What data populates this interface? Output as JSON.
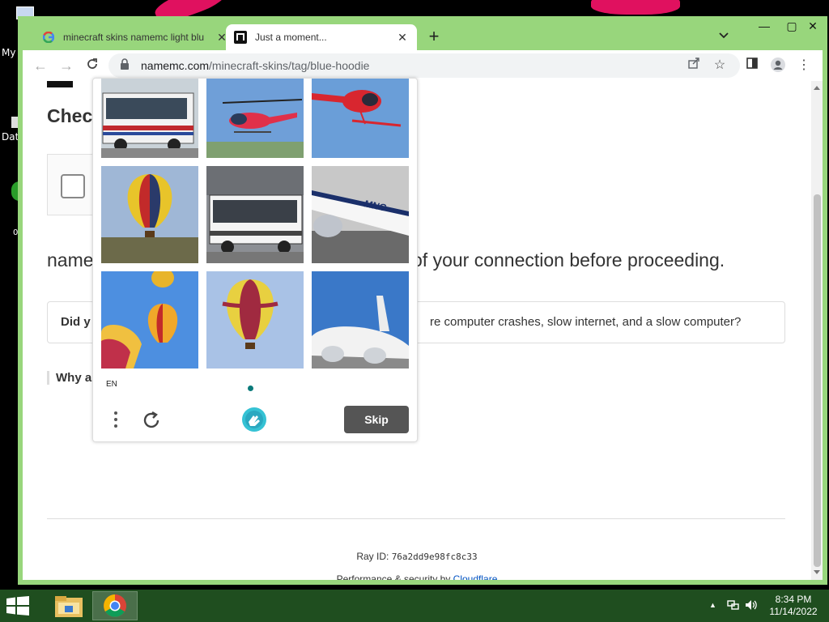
{
  "desktop": {
    "icon_labels": [
      "My",
      "Dat",
      "0"
    ]
  },
  "browser": {
    "tabs": [
      {
        "title": "minecraft skins namemc light blu",
        "favicon": "google-icon",
        "active": false
      },
      {
        "title": "Just a moment...",
        "favicon": "namemc-icon",
        "active": true
      }
    ],
    "url_host": "namemc.com",
    "url_path": "/minecraft-skins/tag/blue-hoodie"
  },
  "page": {
    "heading_partial": "Checl",
    "connection_left": "name",
    "connection_right": "of your connection before proceeding.",
    "ad_left": "Did y",
    "ad_right": "re computer crashes, slow internet, and a slow computer?",
    "why_partial": "Why a",
    "ray_label": "Ray ID:",
    "ray_id": "76a2dd9e98fc8c33",
    "perf_text": "Performance & security by",
    "cf_link": "Cloudflare"
  },
  "captcha": {
    "tiles": [
      {
        "subject": "bus"
      },
      {
        "subject": "helicopter"
      },
      {
        "subject": "helicopter"
      },
      {
        "subject": "hot-air-balloon"
      },
      {
        "subject": "bus"
      },
      {
        "subject": "airplane"
      },
      {
        "subject": "hot-air-balloon"
      },
      {
        "subject": "hot-air-balloon"
      },
      {
        "subject": "airplane"
      }
    ],
    "language": "EN",
    "skip_label": "Skip"
  },
  "taskbar": {
    "time": "8:34 PM",
    "date": "11/14/2022"
  },
  "colors": {
    "window_frame": "#98d67c",
    "taskbar": "#1f4e1f",
    "skip_button": "#555555",
    "cloudflare_link": "#0051c3"
  }
}
